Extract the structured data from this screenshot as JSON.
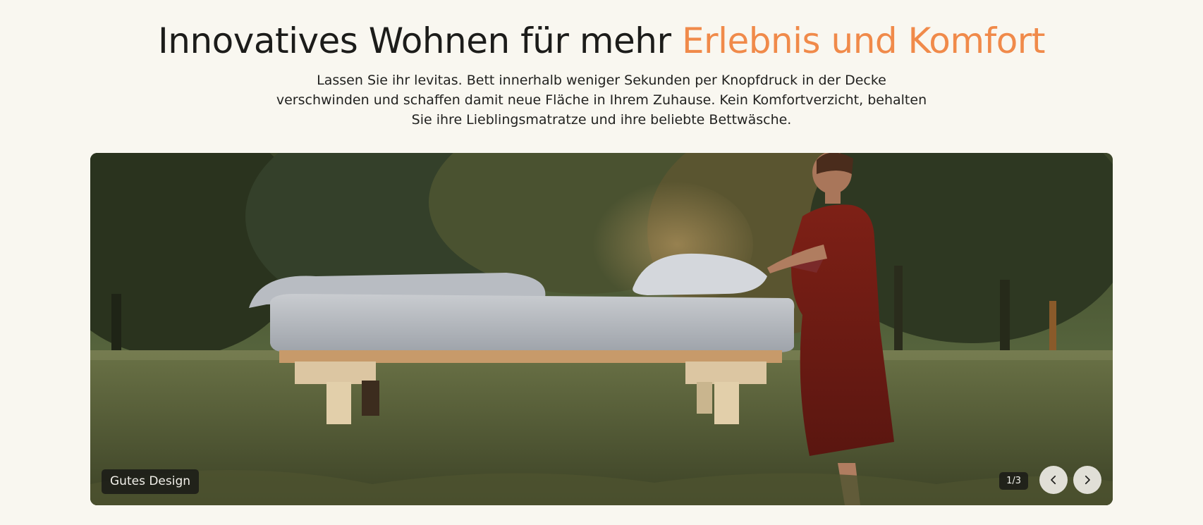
{
  "hero": {
    "title_main": "Innovatives Wohnen für mehr ",
    "title_accent": "Erlebnis und Komfort",
    "description": "Lassen Sie ihr levitas. Bett innerhalb weniger Sekunden per Knopfdruck in der Decke verschwinden und schaffen damit neue Fläche in Ihrem Zuhause. Kein Komfortverzicht, behalten Sie ihre Lieblingsmatratze und ihre beliebte Bettwäsche."
  },
  "slider": {
    "caption": "Gutes Design",
    "counter": "1/3",
    "prev_icon": "chevron-left-icon",
    "next_icon": "chevron-right-icon",
    "current_slide": 1,
    "total_slides": 3
  },
  "colors": {
    "background": "#f9f7f0",
    "accent": "#f08a4a",
    "text": "#1c1c1a"
  }
}
